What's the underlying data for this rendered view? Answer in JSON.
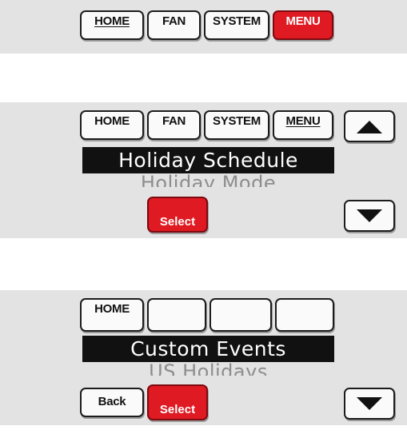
{
  "screen1": {
    "home_label": "HOME",
    "fan_label": "FAN",
    "system_label": "SYSTEM",
    "menu_label": "MENU"
  },
  "screen2": {
    "home_label": "HOME",
    "fan_label": "FAN",
    "system_label": "SYSTEM",
    "menu_label": "MENU",
    "highlighted_item": "Holiday Schedule",
    "next_item": "Holiday Mode",
    "select_label": "Select",
    "up_icon": "up-arrow-icon",
    "down_icon": "down-arrow-icon"
  },
  "screen3": {
    "home_label": "HOME",
    "highlighted_item": "Custom Events",
    "next_item": "US Holidays",
    "back_label": "Back",
    "select_label": "Select",
    "down_icon": "down-arrow-icon"
  },
  "colors": {
    "panel_bg": "#e3e3e3",
    "button_bg": "#fafafa",
    "active_red": "#e01a22",
    "highlight_bar": "#111111",
    "dim_text": "#8d8d8d"
  }
}
